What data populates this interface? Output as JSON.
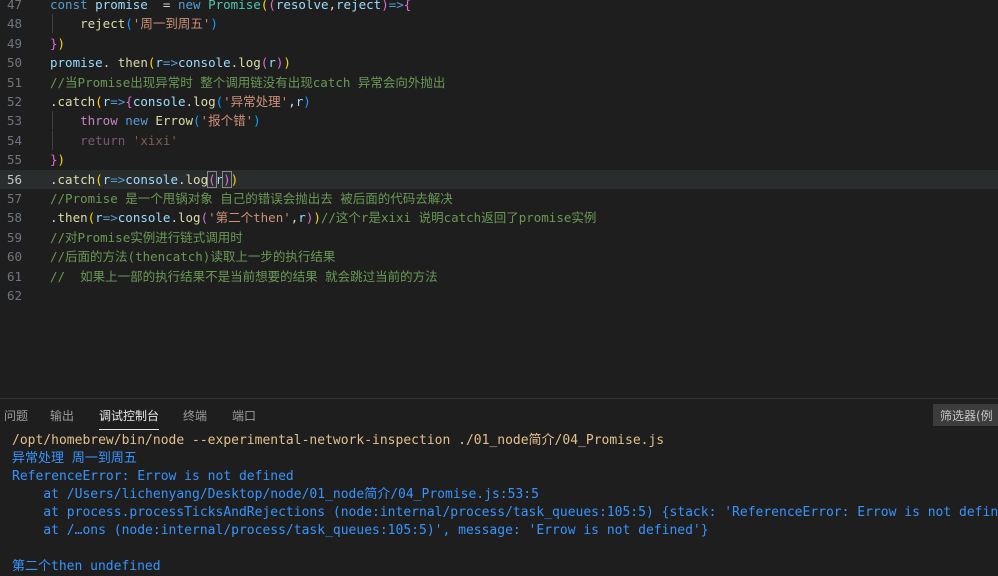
{
  "editor": {
    "lines": [
      {
        "num": "47",
        "tokens": [
          [
            "kw",
            "const "
          ],
          [
            "var",
            "promise"
          ],
          [
            "",
            "  = "
          ],
          [
            "kw",
            "new "
          ],
          [
            "cls",
            "Promise"
          ],
          [
            "yb",
            "("
          ],
          [
            "pb",
            "("
          ],
          [
            "var",
            "resolve"
          ],
          [
            "",
            ","
          ],
          [
            "var",
            "reject"
          ],
          [
            "pb",
            ")"
          ],
          [
            "kw",
            "=>"
          ],
          [
            "pb",
            "{"
          ]
        ]
      },
      {
        "num": "48",
        "tokens": [
          [
            "",
            "    "
          ],
          [
            "fn",
            "reject"
          ],
          [
            "bb",
            "("
          ],
          [
            "str",
            "'周一到周五'"
          ],
          [
            "bb",
            ")"
          ]
        ]
      },
      {
        "num": "49",
        "tokens": [
          [
            "pb",
            "}"
          ],
          [
            "yb",
            ")"
          ]
        ]
      },
      {
        "num": "50",
        "tokens": [
          [
            "var",
            "promise"
          ],
          [
            "",
            ". "
          ],
          [
            "fn",
            "then"
          ],
          [
            "yb",
            "("
          ],
          [
            "var",
            "r"
          ],
          [
            "kw",
            "=>"
          ],
          [
            "var",
            "console"
          ],
          [
            "",
            "."
          ],
          [
            "fn",
            "log"
          ],
          [
            "pb",
            "("
          ],
          [
            "var",
            "r"
          ],
          [
            "pb",
            ")"
          ],
          [
            "yb",
            ")"
          ]
        ]
      },
      {
        "num": "51",
        "tokens": [
          [
            "cm",
            "//当Promise出现异常时 整个调用链没有出现catch 异常会向外抛出"
          ]
        ]
      },
      {
        "num": "52",
        "tokens": [
          [
            "",
            "."
          ],
          [
            "fn",
            "catch"
          ],
          [
            "yb",
            "("
          ],
          [
            "var",
            "r"
          ],
          [
            "kw",
            "=>"
          ],
          [
            "pb",
            "{"
          ],
          [
            "var",
            "console"
          ],
          [
            "",
            "."
          ],
          [
            "fn",
            "log"
          ],
          [
            "bb",
            "("
          ],
          [
            "str",
            "'异常处理'"
          ],
          [
            "",
            ","
          ],
          [
            "var",
            "r"
          ],
          [
            "bb",
            ")"
          ]
        ]
      },
      {
        "num": "53",
        "tokens": [
          [
            "",
            "    "
          ],
          [
            "kw2",
            "throw "
          ],
          [
            "kw",
            "new "
          ],
          [
            "fn",
            "Errow"
          ],
          [
            "bb",
            "("
          ],
          [
            "str",
            "'报个错'"
          ],
          [
            "bb",
            ")"
          ]
        ]
      },
      {
        "num": "54",
        "tokens": [
          [
            "",
            "    "
          ],
          [
            "kw2 dim",
            "return "
          ],
          [
            "str dim",
            "'xixi'"
          ]
        ]
      },
      {
        "num": "55",
        "tokens": [
          [
            "pb",
            "}"
          ],
          [
            "yb",
            ")"
          ]
        ]
      },
      {
        "num": "56",
        "tokens": [
          [
            "",
            "."
          ],
          [
            "fn",
            "catch"
          ],
          [
            "yb",
            "("
          ],
          [
            "var",
            "r"
          ],
          [
            "kw",
            "=>"
          ],
          [
            "var",
            "console"
          ],
          [
            "",
            "."
          ],
          [
            "fn",
            "log"
          ],
          [
            "pb bracket-hl",
            "("
          ],
          [
            "var",
            "r"
          ],
          [
            "pb bracket-hl",
            ")"
          ],
          [
            "yb",
            ")"
          ]
        ]
      },
      {
        "num": "57",
        "tokens": [
          [
            "cm",
            "//Promise 是一个甩锅对象 自己的错误会抛出去 被后面的代码去解决"
          ]
        ]
      },
      {
        "num": "58",
        "tokens": [
          [
            "",
            "."
          ],
          [
            "fn",
            "then"
          ],
          [
            "yb",
            "("
          ],
          [
            "var",
            "r"
          ],
          [
            "kw",
            "=>"
          ],
          [
            "var",
            "console"
          ],
          [
            "",
            "."
          ],
          [
            "fn",
            "log"
          ],
          [
            "pb",
            "("
          ],
          [
            "str",
            "'第二个then'"
          ],
          [
            "",
            ","
          ],
          [
            "var",
            "r"
          ],
          [
            "pb",
            ")"
          ],
          [
            "yb",
            ")"
          ],
          [
            "cm",
            "//这个r是xixi 说明catch返回了promise实例"
          ]
        ]
      },
      {
        "num": "59",
        "tokens": [
          [
            "cm",
            "//对Promise实例进行链式调用时"
          ]
        ]
      },
      {
        "num": "60",
        "tokens": [
          [
            "cm",
            "//后面的方法(thencatch)读取上一步的执行结果"
          ]
        ]
      },
      {
        "num": "61",
        "tokens": [
          [
            "cm",
            "//  如果上一部的执行结果不是当前想要的结果 就会跳过当前的方法"
          ]
        ]
      },
      {
        "num": "62",
        "tokens": []
      }
    ]
  },
  "panel": {
    "tabs": [
      "问题",
      "输出",
      "调试控制台",
      "终端",
      "端口"
    ],
    "active_tab": 2,
    "filter_placeholder": "筛选器(例",
    "output": [
      {
        "cls": "o-cmd",
        "text": "/opt/homebrew/bin/node --experimental-network-inspection ./01_node简介/04_Promise.js"
      },
      {
        "cls": "o-blue",
        "text": "异常处理 周一到周五"
      },
      {
        "cls": "o-blue",
        "text": "ReferenceError: Errow is not defined"
      },
      {
        "cls": "o-blue",
        "text": "    at /Users/lichenyang/Desktop/node/01_node简介/04_Promise.js:53:5"
      },
      {
        "cls": "o-blue",
        "text": "    at process.processTicksAndRejections (node:internal/process/task_queues:105:5) {stack: 'ReferenceError: Errow is not defined"
      },
      {
        "cls": "o-blue",
        "text": "    at /…ons (node:internal/process/task_queues:105:5)', message: 'Errow is not defined'}"
      },
      {
        "cls": "o-blue",
        "text": ""
      },
      {
        "cls": "o-blue",
        "text": "第二个then undefined"
      }
    ]
  }
}
